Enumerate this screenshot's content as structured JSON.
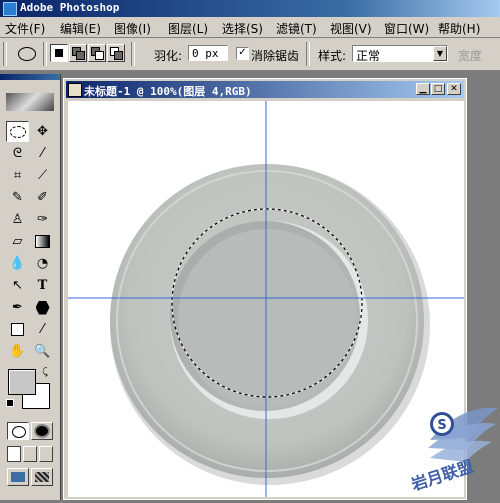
{
  "app": {
    "title": "Adobe Photoshop"
  },
  "menu": [
    "文件(F)",
    "编辑(E)",
    "图像(I)",
    "图层(L)",
    "选择(S)",
    "滤镜(T)",
    "视图(V)",
    "窗口(W)",
    "帮助(H)"
  ],
  "options": {
    "feather_label": "羽化:",
    "feather_value": "0 px",
    "antialias_label": "消除锯齿",
    "antialias_checked": true,
    "style_label": "样式:",
    "style_value": "正常",
    "width_label": "宽度"
  },
  "document": {
    "title": "未标题-1 @ 100%(图层 4,RGB)"
  },
  "watermark": {
    "text": "岩月联盟"
  }
}
